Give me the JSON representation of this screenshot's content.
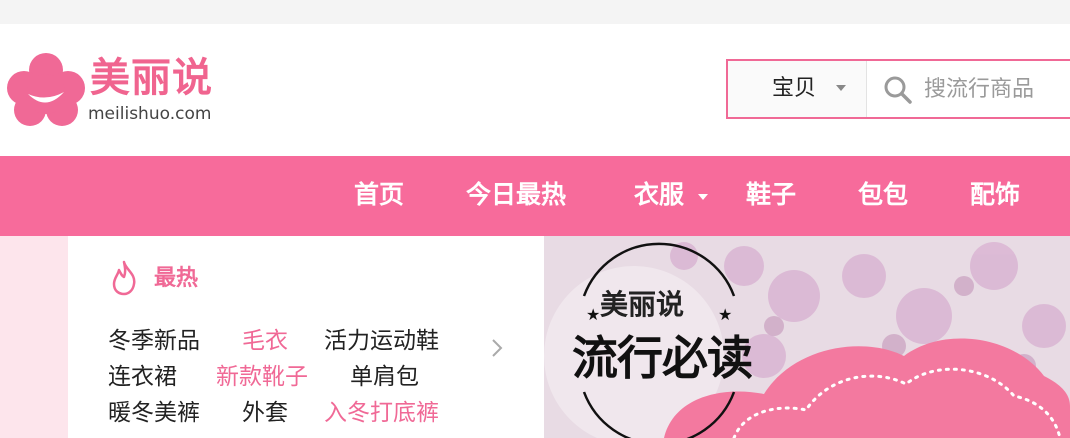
{
  "logo": {
    "name": "美丽说",
    "domain": "meilishuo.com"
  },
  "search": {
    "type_label": "宝贝",
    "placeholder": "搜流行商品"
  },
  "nav": {
    "items": [
      "首页",
      "今日最热",
      "衣服",
      "鞋子",
      "包包",
      "配饰"
    ]
  },
  "hot": {
    "title": "最热",
    "rows": [
      [
        {
          "text": "冬季新品",
          "highlight": false
        },
        {
          "text": "毛衣",
          "highlight": true
        },
        {
          "text": "活力运动鞋",
          "highlight": false
        }
      ],
      [
        {
          "text": "连衣裙",
          "highlight": false
        },
        {
          "text": "新款靴子",
          "highlight": true
        },
        {
          "text": "单肩包",
          "highlight": false
        }
      ],
      [
        {
          "text": "暖冬美裤",
          "highlight": false
        },
        {
          "text": "外套",
          "highlight": false
        },
        {
          "text": "入冬打底裤",
          "highlight": true
        }
      ]
    ]
  },
  "banner": {
    "brand": "美丽说",
    "slogan": "流行必读"
  },
  "colors": {
    "brand_pink": "#f06996",
    "nav_pink": "#f76b9b",
    "text_dark": "#222222",
    "placeholder_gray": "#9a9a9a"
  },
  "icons": {
    "logo": "flower-logo-icon",
    "search": "search-icon",
    "hot": "flame-icon",
    "more": "chevron-right-icon"
  }
}
